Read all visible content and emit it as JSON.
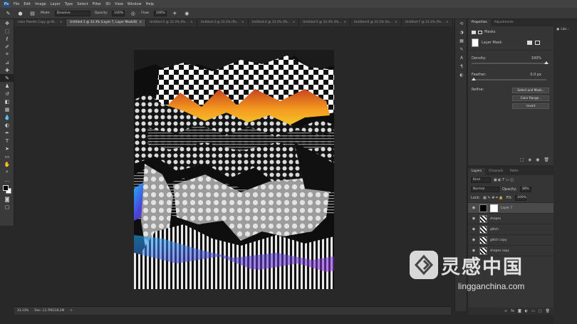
{
  "app": {
    "logo": "Ps"
  },
  "menu": [
    "File",
    "Edit",
    "Image",
    "Layer",
    "Type",
    "Select",
    "Filter",
    "3D",
    "View",
    "Window",
    "Help"
  ],
  "options": {
    "mode_label": "Mode:",
    "mode_value": "Dissolve",
    "opacity_label": "Opacity:",
    "opacity_value": "100%",
    "flow_label": "Flow:",
    "flow_value": "100%"
  },
  "tabs": [
    {
      "label": "color Palette Copy @ 66...",
      "close": "×"
    },
    {
      "label": "Untitled-1 @ 33.3% (Layer 7, Layer Mask/8)",
      "close": "×",
      "active": true
    },
    {
      "label": "Untitled-2 @ 33.3% (Pa...",
      "close": "×"
    },
    {
      "label": "Untitled-3 @ 33.3% (Pa...",
      "close": "×"
    },
    {
      "label": "Untitled-4 @ 33.3% (Pa...",
      "close": "×"
    },
    {
      "label": "Untitled-5 @ 33.3% (Pa...",
      "close": "×"
    },
    {
      "label": "Untitled-6 @ 33.3% (lin...",
      "close": "×"
    },
    {
      "label": "Untitled-7 @ 33.3% (Pa...",
      "close": "×"
    }
  ],
  "status": {
    "zoom": "33.33%",
    "doc": "Doc: 13.7M/218.2M",
    "arrow": ">"
  },
  "properties": {
    "tabs": [
      "Properties",
      "Adjustments"
    ],
    "masks_label": "Masks",
    "layer_mask_label": "Layer Mask",
    "density_label": "Density:",
    "density_value": "100%",
    "density_level": 1.0,
    "feather_label": "Feather:",
    "feather_value": "0.0 px",
    "feather_level": 0.0,
    "refine_label": "Refine:",
    "buttons": [
      "Select and Mask...",
      "Color Range...",
      "Invert"
    ]
  },
  "layers": {
    "tabs": [
      "Layers",
      "Channels",
      "Paths"
    ],
    "kind": "Kind",
    "blend": "Normal",
    "opacity_label": "Opacity:",
    "opacity_value": "38%",
    "lock_label": "Lock:",
    "fill_label": "Fill:",
    "fill_value": "100%",
    "items": [
      {
        "name": "Layer 7",
        "active": true,
        "mask": true
      },
      {
        "name": "shapes"
      },
      {
        "name": "glitch"
      },
      {
        "name": "glitch copy"
      },
      {
        "name": "shapes copy"
      }
    ]
  },
  "right": {
    "label": "Libr..."
  },
  "watermark": {
    "cn": "灵感中国",
    "url": "lingganchina.com"
  },
  "colors": {
    "accent": "#2c4e7a",
    "selection": "#4a4a4a"
  }
}
